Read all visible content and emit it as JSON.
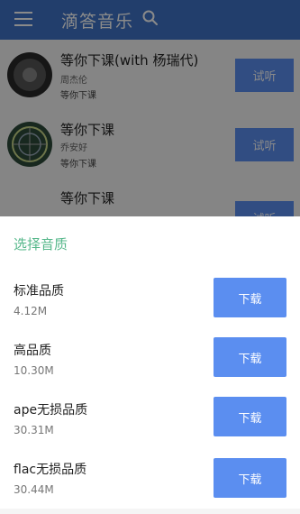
{
  "appbar": {
    "title": "滴答音乐",
    "menu_icon": "menu-icon",
    "search_icon": "search-icon",
    "color": "#3f74c8"
  },
  "songs": [
    {
      "title": "等你下课(with 杨瑞代)",
      "artist": "周杰伦",
      "album": "等你下课",
      "listen_label": "试听"
    },
    {
      "title": "等你下课",
      "artist": "乔安好",
      "album": "等你下课",
      "listen_label": "试听"
    },
    {
      "title": "等你下课",
      "artist": "",
      "album": "",
      "listen_label": "试听"
    }
  ],
  "quality_sheet": {
    "title": "选择音质",
    "title_color": "#55b78a",
    "options": [
      {
        "name": "标准品质",
        "size": "4.12M",
        "button_label": "下载"
      },
      {
        "name": "高品质",
        "size": "10.30M",
        "button_label": "下载"
      },
      {
        "name": "ape无损品质",
        "size": "30.31M",
        "button_label": "下载"
      },
      {
        "name": "flac无损品质",
        "size": "30.44M",
        "button_label": "下载"
      }
    ]
  },
  "accent_color": "#5b8ef0"
}
